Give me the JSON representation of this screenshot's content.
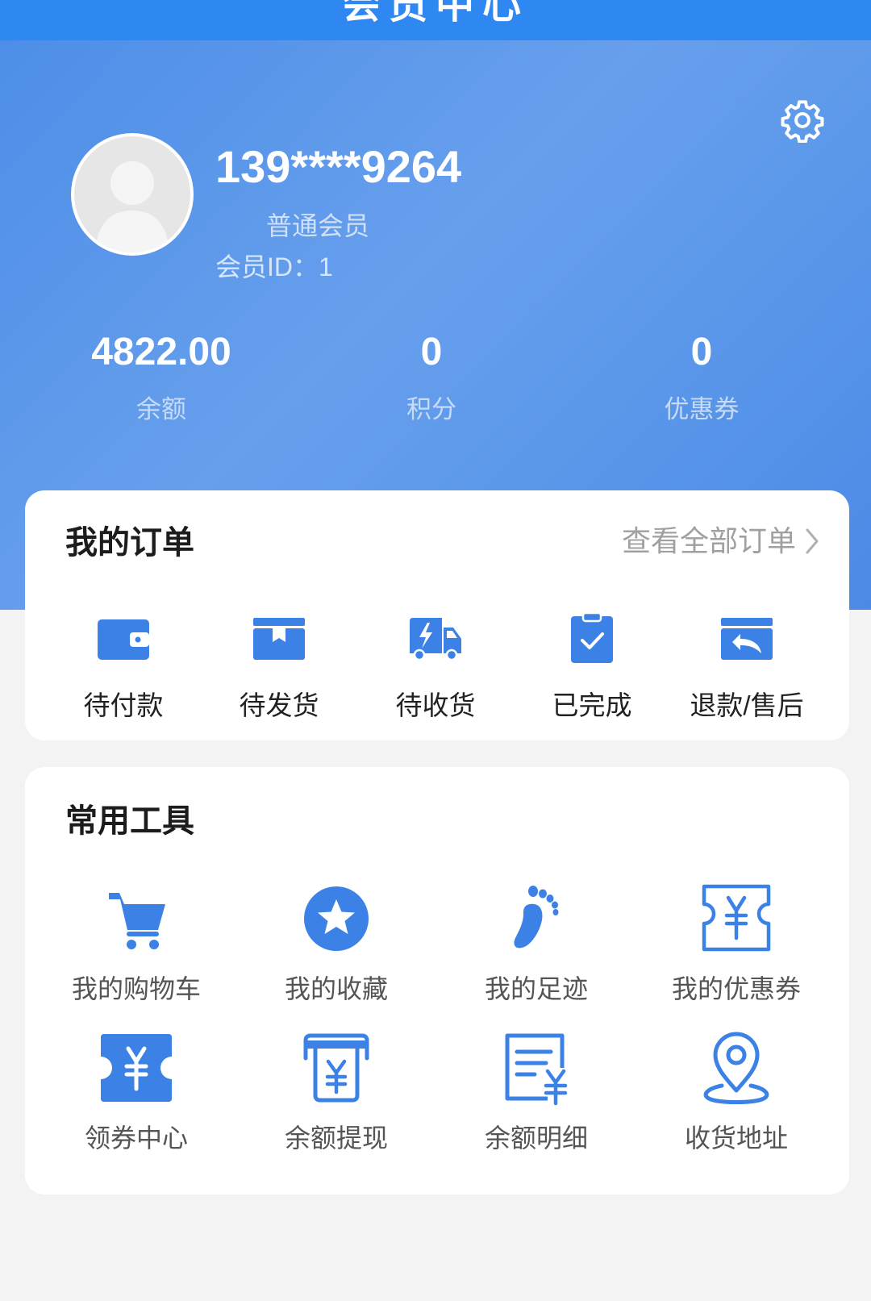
{
  "header": {
    "title": "会员中心"
  },
  "profile": {
    "username": "139****9264",
    "level": "普通会员",
    "member_id": "会员ID：1"
  },
  "stats": [
    {
      "value": "4822.00",
      "label": "余额"
    },
    {
      "value": "0",
      "label": "积分"
    },
    {
      "value": "0",
      "label": "优惠券"
    }
  ],
  "orders": {
    "title": "我的订单",
    "view_all": "查看全部订单",
    "items": [
      {
        "label": "待付款",
        "icon": "wallet-icon"
      },
      {
        "label": "待发货",
        "icon": "box-icon"
      },
      {
        "label": "待收货",
        "icon": "truck-icon"
      },
      {
        "label": "已完成",
        "icon": "clipboard-check-icon"
      },
      {
        "label": "退款/售后",
        "icon": "return-box-icon"
      }
    ]
  },
  "tools": {
    "title": "常用工具",
    "items": [
      {
        "label": "我的购物车",
        "icon": "cart-icon"
      },
      {
        "label": "我的收藏",
        "icon": "star-icon"
      },
      {
        "label": "我的足迹",
        "icon": "footprint-icon"
      },
      {
        "label": "我的优惠券",
        "icon": "coupon-outline-icon"
      },
      {
        "label": "领券中心",
        "icon": "coupon-filled-icon"
      },
      {
        "label": "余额提现",
        "icon": "withdraw-icon"
      },
      {
        "label": "余额明细",
        "icon": "statement-icon"
      },
      {
        "label": "收货地址",
        "icon": "location-pin-icon"
      }
    ]
  },
  "colors": {
    "accent": "#3c82e6",
    "topbar": "#2f87f1",
    "hero": "#5a97ea"
  }
}
